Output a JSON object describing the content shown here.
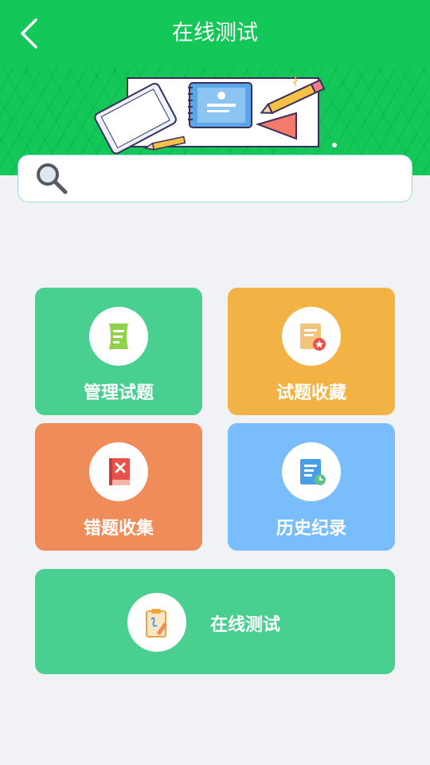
{
  "header": {
    "title": "在线测试",
    "background_color": "#13c858"
  },
  "search": {
    "placeholder": "",
    "value": ""
  },
  "tiles": [
    {
      "label": "管理试题",
      "color": "#49cf8f",
      "icon": "scroll-document-icon"
    },
    {
      "label": "试题收藏",
      "color": "#f3b344",
      "icon": "favorite-document-icon"
    },
    {
      "label": "错题收集",
      "color": "#f08c5a",
      "icon": "wrong-book-icon"
    },
    {
      "label": "历史纪录",
      "color": "#7abdfb",
      "icon": "history-document-icon"
    }
  ],
  "online_test": {
    "label": "在线测试",
    "color": "#49cf8f",
    "icon": "clipboard-pen-icon"
  }
}
